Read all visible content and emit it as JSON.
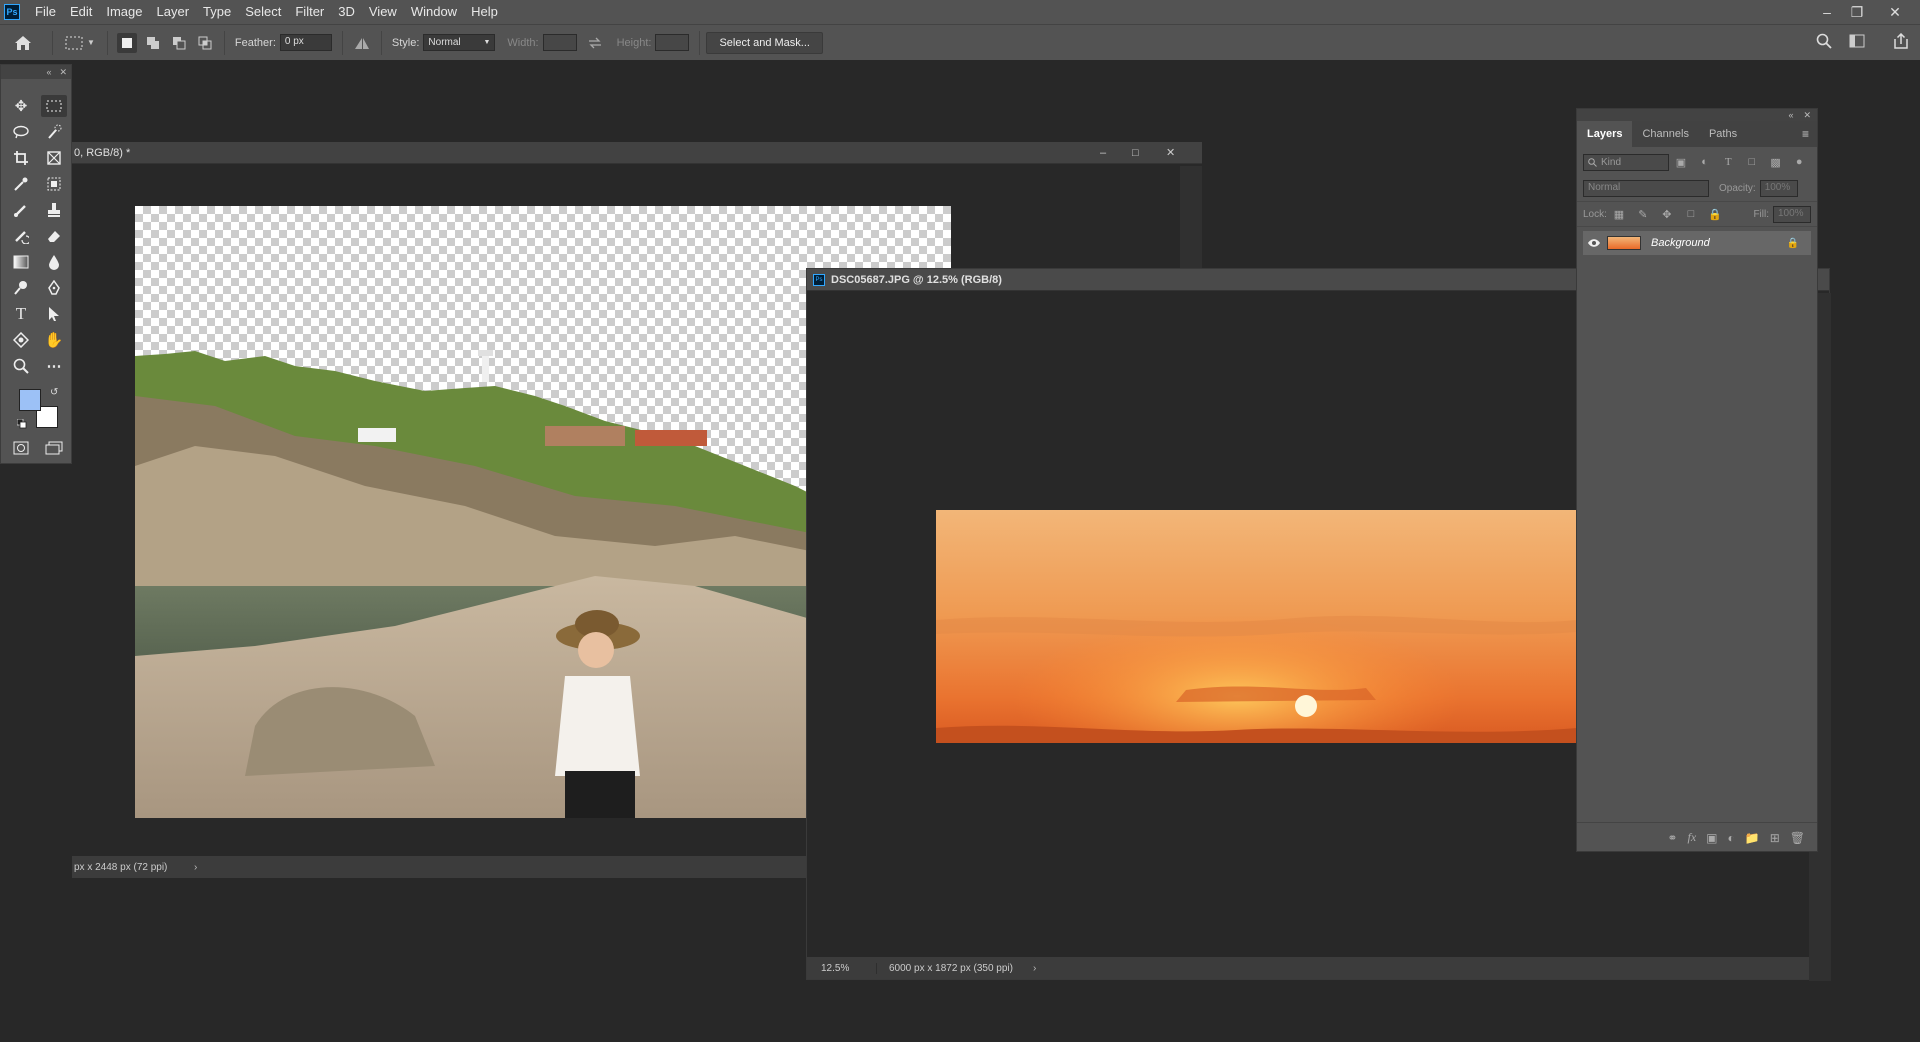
{
  "app": {
    "logo_text": "Ps"
  },
  "menu": [
    "File",
    "Edit",
    "Image",
    "Layer",
    "Type",
    "Select",
    "Filter",
    "3D",
    "View",
    "Window",
    "Help"
  ],
  "options": {
    "feather_label": "Feather:",
    "feather_value": "0 px",
    "style_label": "Style:",
    "style_value": "Normal",
    "width_label": "Width:",
    "height_label": "Height:",
    "select_mask_label": "Select and Mask..."
  },
  "doc1": {
    "title": "0, RGB/8) *",
    "status": "px x 2448 px (72 ppi)"
  },
  "doc2": {
    "title": "DSC05687.JPG @ 12.5% (RGB/8)",
    "zoom": "12.5%",
    "status": "6000 px x 1872 px (350 ppi)"
  },
  "layers_panel": {
    "tabs": [
      "Layers",
      "Channels",
      "Paths"
    ],
    "kind_placeholder": "Kind",
    "blend_mode": "Normal",
    "opacity_label": "Opacity:",
    "opacity_value": "100%",
    "lock_label": "Lock:",
    "fill_label": "Fill:",
    "fill_value": "100%",
    "layer_name": "Background"
  },
  "colors": {
    "foreground": "#9cc1f6",
    "background": "#ffffff",
    "ui_bg": "#535353",
    "canvas_bg": "#282828"
  }
}
